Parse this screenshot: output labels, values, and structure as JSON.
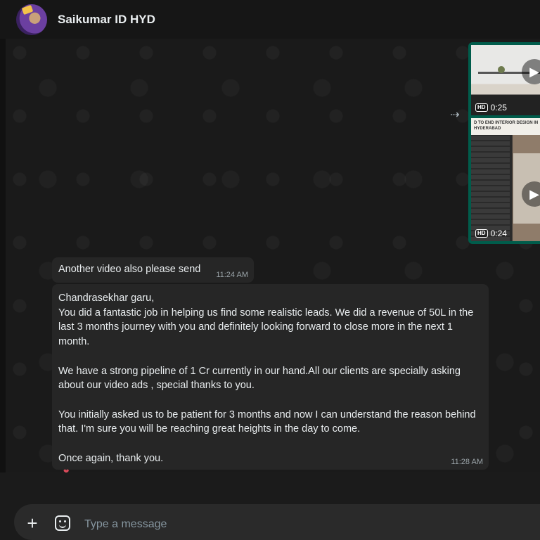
{
  "header": {
    "contact_name": "Saikumar ID HYD"
  },
  "media": {
    "videos": [
      {
        "duration": "0:25",
        "quality_badge": "HD",
        "icon": "play-icon"
      },
      {
        "duration": "0:24",
        "quality_badge": "HD",
        "icon": "play-icon",
        "thumbnail_text": "D TO END INTERIOR DESIGN IN HYDERABAD"
      }
    ],
    "forward_icon": "forward-icon"
  },
  "messages": [
    {
      "text": "Another video also please send",
      "time": "11:24 AM"
    },
    {
      "paragraphs": [
        "Chandrasekhar garu,",
        "You did a fantastic job in helping us find some realistic leads. We did a revenue of 50L in the last 3 months journey with you and definitely looking forward to close more in the next 1 month.",
        "We have a strong pipeline of 1 Cr currently in our hand.All our clients are specially asking about our video ads , special thanks to you.",
        "You initially asked us to be patient for 3 months and now I can understand the reason behind that. I'm sure you will be reaching great heights in the day to come.",
        "Once again, thank you."
      ],
      "time": "11:28 AM",
      "reaction": "❤"
    }
  ],
  "composer": {
    "placeholder": "Type a message",
    "plus_icon": "plus-icon",
    "emoji_icon": "sticker-icon"
  },
  "colors": {
    "chat_bg": "#1a1a1a",
    "bubble_bg": "#262626",
    "accent": "#005c4b"
  }
}
